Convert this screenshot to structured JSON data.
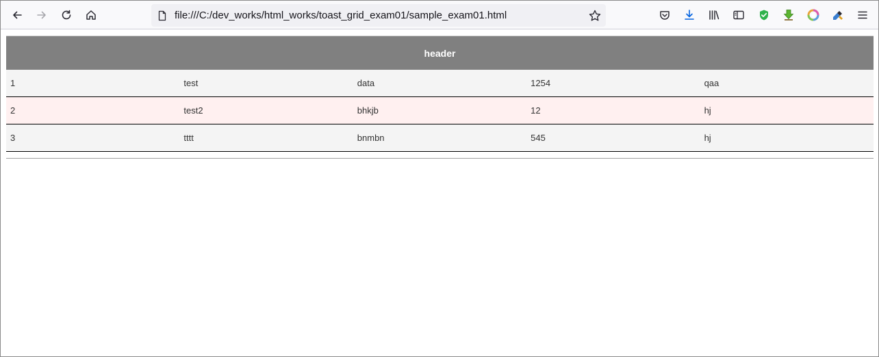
{
  "browser": {
    "url": "file:///C:/dev_works/html_works/toast_grid_exam01/sample_exam01.html",
    "icons": {
      "back": "arrow-left-icon",
      "forward": "arrow-right-icon",
      "reload": "reload-icon",
      "home": "home-icon",
      "page": "page-icon",
      "bookmark": "star-icon",
      "pocket": "pocket-icon",
      "downloads": "download-icon",
      "library": "library-icon",
      "sidebar": "sidebar-icon",
      "extension1": "shield-check-icon",
      "extension2": "green-download-arrow-icon",
      "extension3": "color-wheel-icon",
      "extension4": "picker-icon",
      "menu": "hamburger-menu-icon"
    }
  },
  "grid": {
    "header": "header",
    "rows": [
      {
        "c1": "1",
        "c2": "test",
        "c3": "data",
        "c4": "1254",
        "c5": "qaa"
      },
      {
        "c1": "2",
        "c2": "test2",
        "c3": "bhkjb",
        "c4": "12",
        "c5": "hj"
      },
      {
        "c1": "3",
        "c2": "tttt",
        "c3": "bnmbn",
        "c4": "545",
        "c5": "hj"
      }
    ],
    "colors": {
      "header_bg": "#808080",
      "row_odd_bg": "#f4f4f4",
      "row_even_bg": "#fff0f0",
      "row_border": "#000000"
    }
  }
}
